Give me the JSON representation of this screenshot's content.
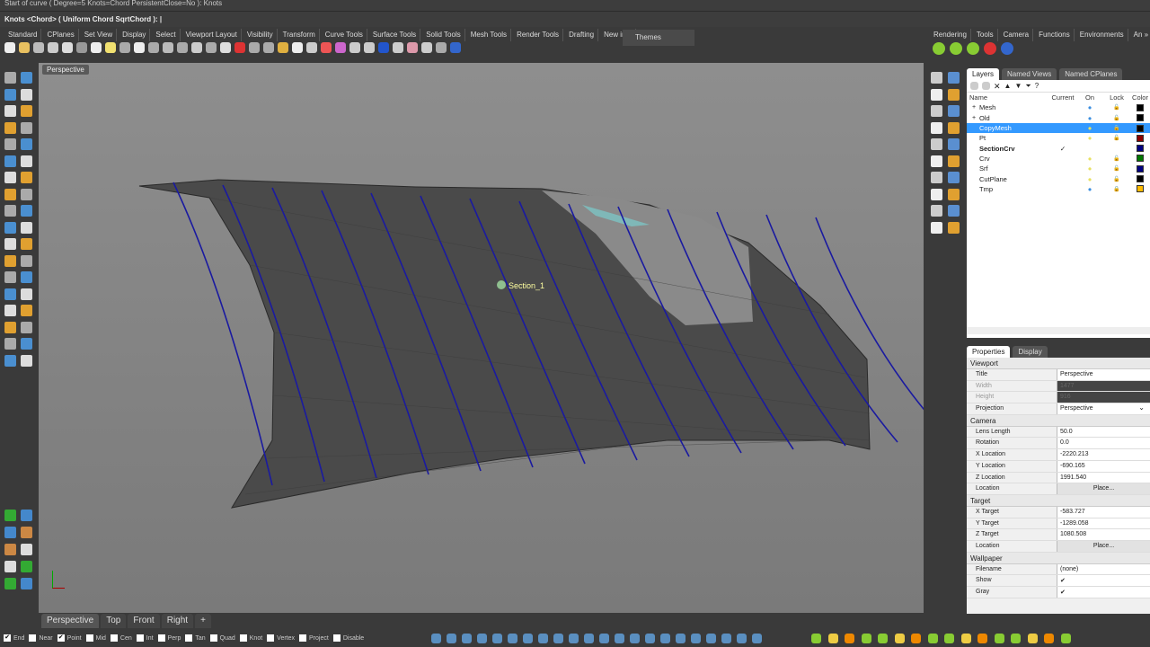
{
  "command_history": "Start of curve ( Degree=5  Knots=Chord  PersistentClose=No ): Knots",
  "command_prompt": "Knots <Chord> ( Uniform  Chord  SqrtChord ): ",
  "toolbar_tabs": [
    "Standard",
    "CPlanes",
    "Set View",
    "Display",
    "Select",
    "Viewport Layout",
    "Visibility",
    "Transform",
    "Curve Tools",
    "Surface Tools",
    "Solid Tools",
    "Mesh Tools",
    "Render Tools",
    "Drafting",
    "New in »"
  ],
  "themes_label": "Themes",
  "right_toolbar_tabs": [
    "Rendering",
    "Tools",
    "Camera",
    "Functions",
    "Environments",
    "An »"
  ],
  "viewport": {
    "title": "Perspective",
    "section_label": "Section_1"
  },
  "layers_panel": {
    "tabs": [
      "Layers",
      "Named Views",
      "Named CPlanes"
    ],
    "columns": [
      "Name",
      "Current",
      "On",
      "Lock",
      "Color"
    ],
    "rows": [
      {
        "name": "Mesh",
        "expand": "+",
        "current": "",
        "on": "blue",
        "lock": "open",
        "color": "#000000"
      },
      {
        "name": "Old",
        "expand": "+",
        "current": "",
        "on": "blue",
        "lock": "open",
        "color": "#000000"
      },
      {
        "name": "CopyMesh",
        "expand": "",
        "current": "",
        "on": "yellow",
        "lock": "locked",
        "color": "#000000",
        "selected": true
      },
      {
        "name": "Pt",
        "expand": "",
        "current": "",
        "on": "yellow",
        "lock": "open",
        "color": "#8b0000"
      },
      {
        "name": "SectionCrv",
        "expand": "",
        "current": "✓",
        "on": "",
        "lock": "",
        "color": "#000080"
      },
      {
        "name": "Crv",
        "expand": "",
        "current": "",
        "on": "yellow",
        "lock": "open",
        "color": "#007700"
      },
      {
        "name": "Srf",
        "expand": "",
        "current": "",
        "on": "yellow",
        "lock": "open",
        "color": "#000080"
      },
      {
        "name": "CutPlane",
        "expand": "",
        "current": "",
        "on": "yellow",
        "lock": "open",
        "color": "#000000"
      },
      {
        "name": "Tmp",
        "expand": "",
        "current": "",
        "on": "blue",
        "lock": "locked",
        "color": "#ffbb00"
      }
    ]
  },
  "properties_panel": {
    "tabs": [
      "Properties",
      "Display"
    ],
    "sections": [
      {
        "title": "Viewport",
        "rows": [
          {
            "key": "Title",
            "value": "Perspective"
          },
          {
            "key": "Width",
            "value": "1477",
            "disabled": true
          },
          {
            "key": "Height",
            "value": "916",
            "disabled": true
          },
          {
            "key": "Projection",
            "value": "Perspective",
            "dropdown": true
          }
        ]
      },
      {
        "title": "Camera",
        "rows": [
          {
            "key": "Lens Length",
            "value": "50.0"
          },
          {
            "key": "Rotation",
            "value": "0.0"
          },
          {
            "key": "X Location",
            "value": "-2220.213"
          },
          {
            "key": "Y Location",
            "value": "-690.165"
          },
          {
            "key": "Z Location",
            "value": "1991.540"
          },
          {
            "key": "Location",
            "value": "Place...",
            "button": true
          }
        ]
      },
      {
        "title": "Target",
        "rows": [
          {
            "key": "X Target",
            "value": "-583.727"
          },
          {
            "key": "Y Target",
            "value": "-1289.058"
          },
          {
            "key": "Z Target",
            "value": "1080.508"
          },
          {
            "key": "Location",
            "value": "Place...",
            "button": true
          }
        ]
      },
      {
        "title": "Wallpaper",
        "rows": [
          {
            "key": "Filename",
            "value": "(none)"
          },
          {
            "key": "Show",
            "value": "✔"
          },
          {
            "key": "Gray",
            "value": "✔"
          }
        ]
      }
    ]
  },
  "viewport_tabs": [
    "Perspective",
    "Top",
    "Front",
    "Right",
    "+"
  ],
  "osnaps": [
    {
      "label": "End",
      "checked": true
    },
    {
      "label": "Near",
      "checked": false
    },
    {
      "label": "Point",
      "checked": true
    },
    {
      "label": "Mid",
      "checked": false
    },
    {
      "label": "Cen",
      "checked": false
    },
    {
      "label": "Int",
      "checked": false
    },
    {
      "label": "Perp",
      "checked": false
    },
    {
      "label": "Tan",
      "checked": false
    },
    {
      "label": "Quad",
      "checked": false
    },
    {
      "label": "Knot",
      "checked": false
    },
    {
      "label": "Vertex",
      "checked": false
    },
    {
      "label": "Project",
      "checked": false
    },
    {
      "label": "Disable",
      "checked": false
    }
  ]
}
